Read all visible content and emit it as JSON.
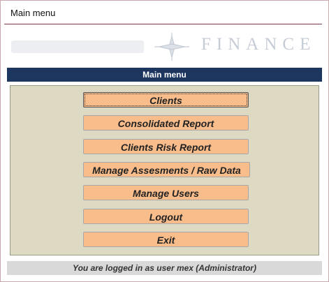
{
  "window": {
    "title": "Main menu"
  },
  "logo": {
    "text": "FINANCE"
  },
  "header": {
    "title": "Main menu"
  },
  "menu": {
    "buttons": [
      {
        "label": "Clients"
      },
      {
        "label": "Consolidated Report"
      },
      {
        "label": "Clients Risk Report"
      },
      {
        "label": "Manage Assesments / Raw Data"
      },
      {
        "label": "Manage Users"
      },
      {
        "label": "Logout"
      },
      {
        "label": "Exit"
      }
    ]
  },
  "status": {
    "text": "You are logged in as user mex (Administrator)"
  },
  "colors": {
    "header_bg": "#1c3660",
    "panel_bg": "#ddd9c3",
    "button_bg": "#f9bd8c",
    "status_bg": "#d9d9d9"
  }
}
